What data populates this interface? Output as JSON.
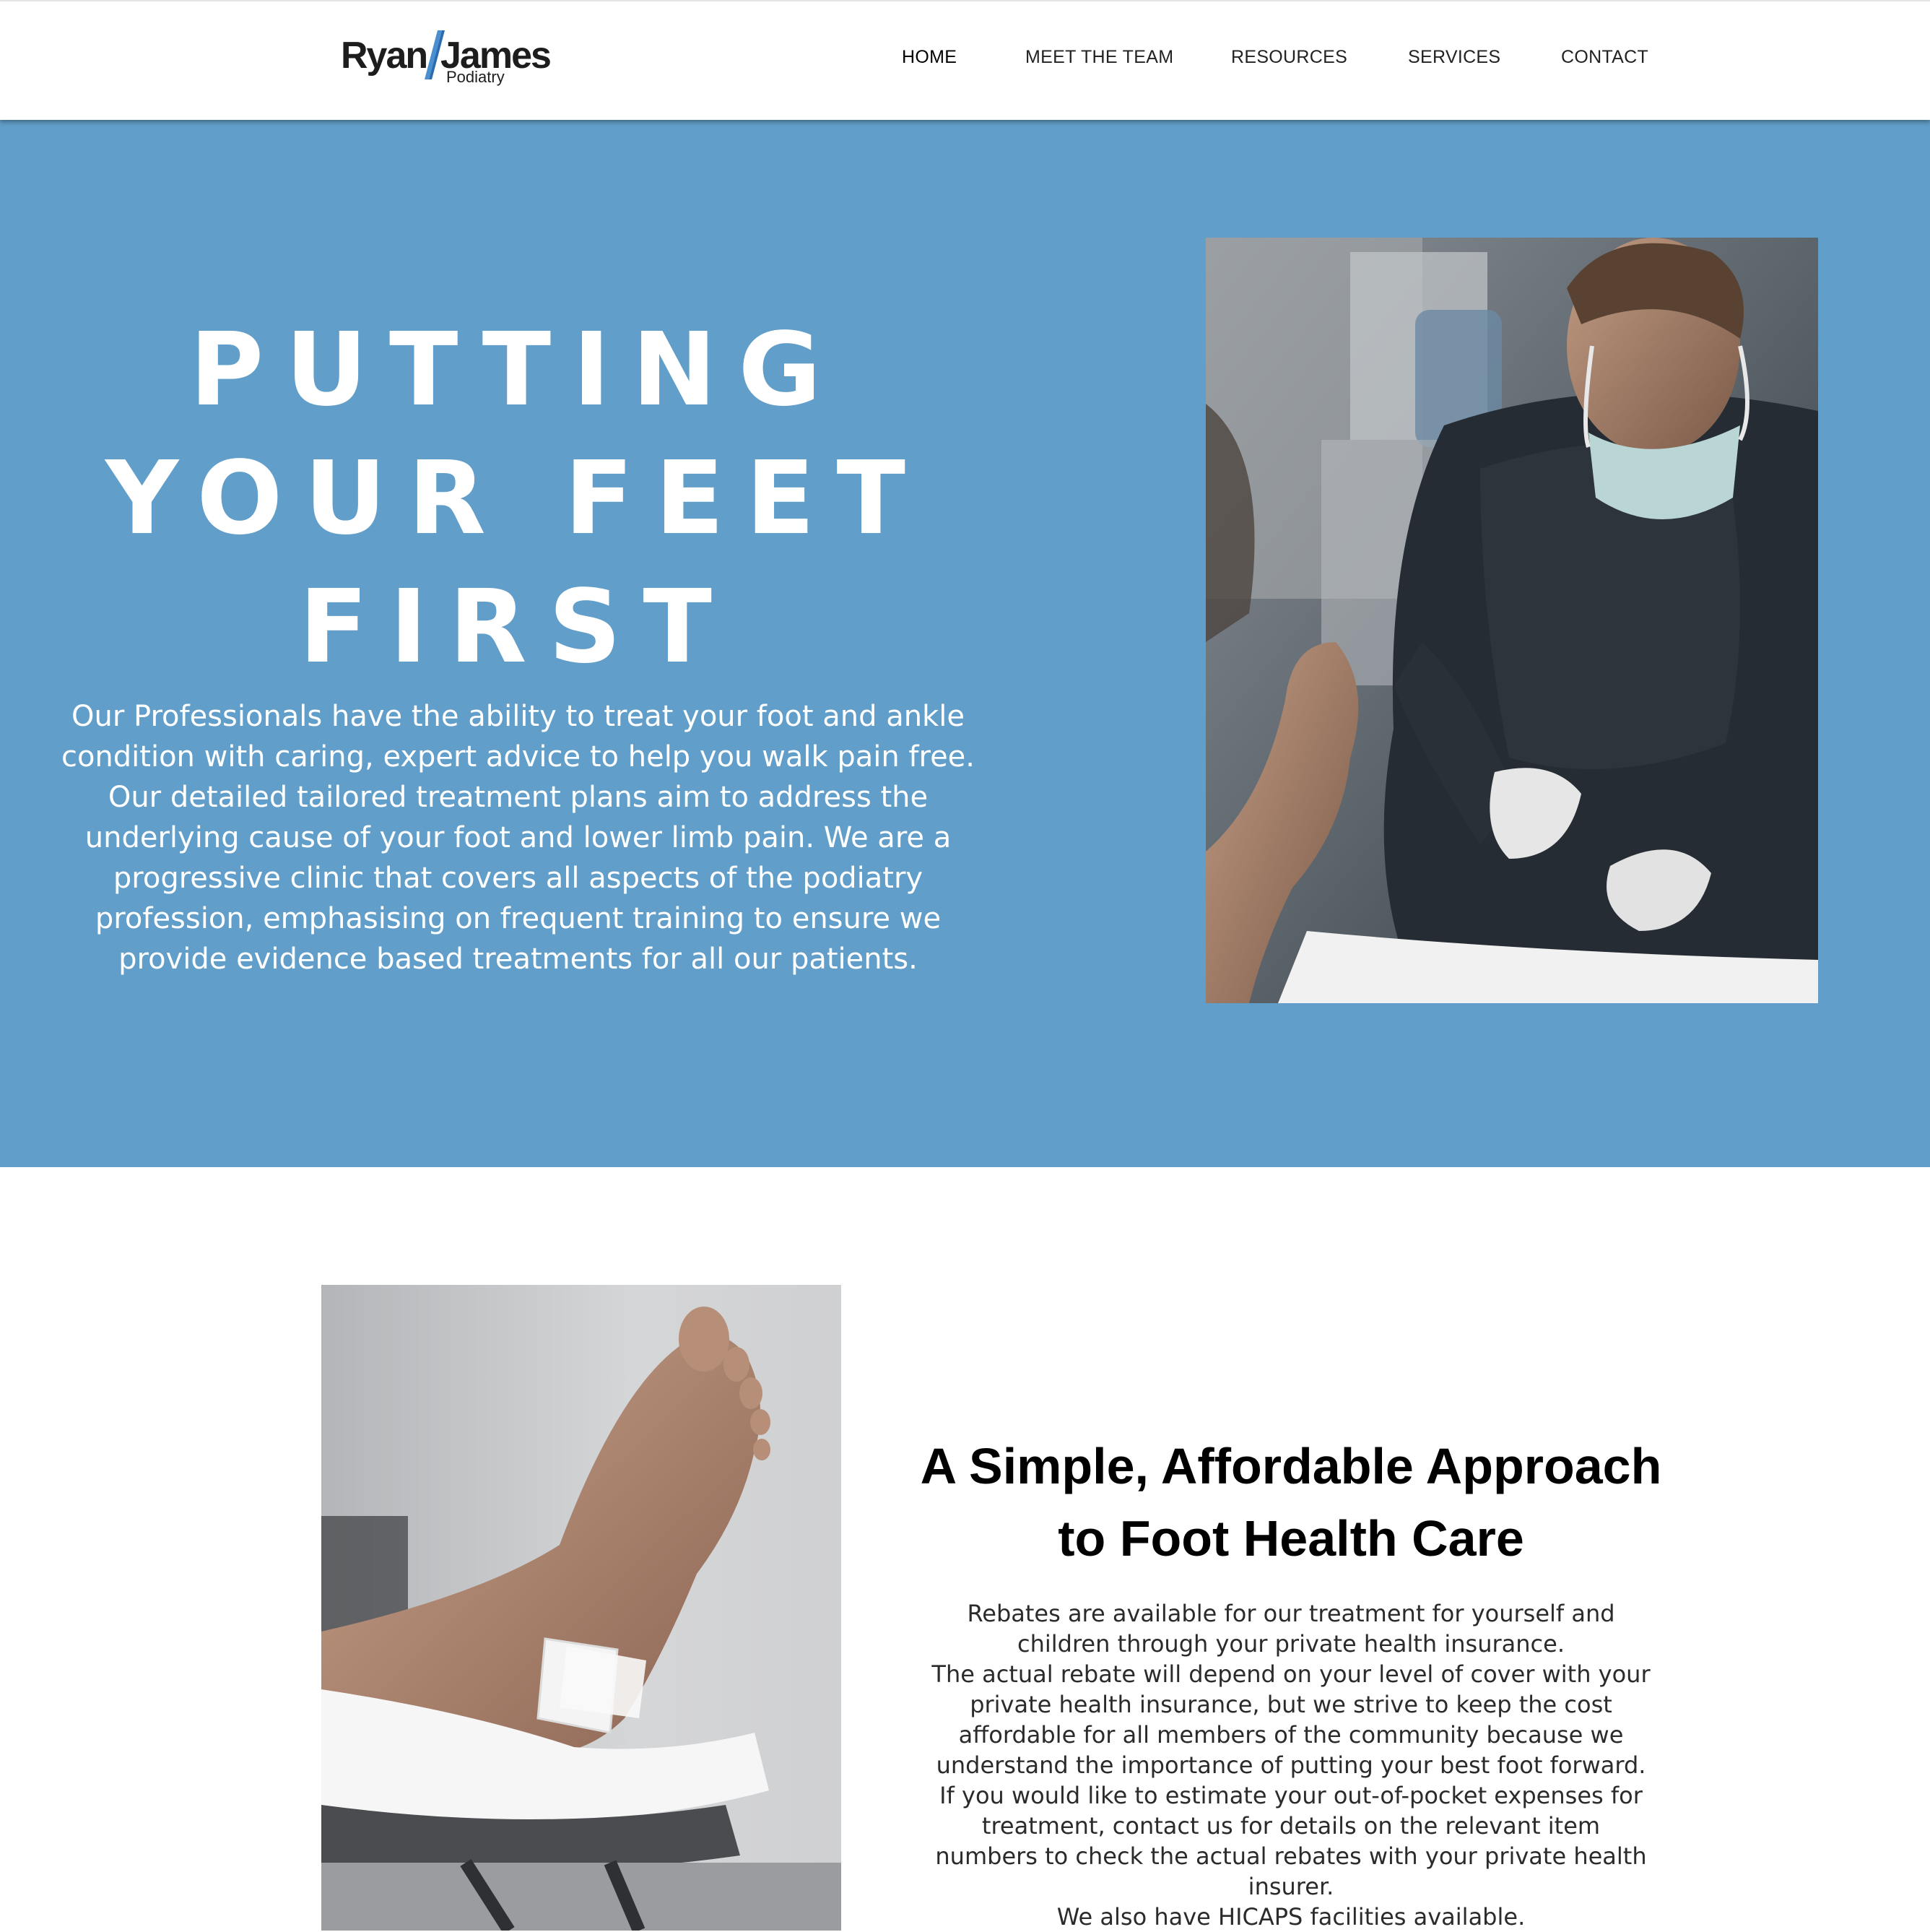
{
  "header": {
    "logo": {
      "word_left": "Ryan",
      "word_right": "James",
      "subtitle": "Podiatry",
      "accent_color": "#4a8fd0"
    },
    "nav": [
      {
        "label": "HOME",
        "active": true
      },
      {
        "label": "MEET THE TEAM",
        "active": false
      },
      {
        "label": "RESOURCES",
        "active": false
      },
      {
        "label": "SERVICES",
        "active": false
      },
      {
        "label": "CONTACT",
        "active": false
      }
    ]
  },
  "hero": {
    "background_color": "#619ec9",
    "title_lines": [
      "PUTTING",
      "YOUR FEET",
      "FIRST"
    ],
    "description": "Our Professionals have the ability to treat your foot and ankle condition with caring, expert advice to help you walk pain free.  Our detailed tailored treatment plans aim to address the underlying cause of your foot and lower limb pain. We are a progressive clinic that covers all aspects of the podiatry profession, emphasising on frequent training to ensure we provide evidence based treatments for all our patients."
  },
  "affordable": {
    "title": "A Simple, Affordable Approach to Foot Health Care",
    "paragraphs": [
      "Rebates are available for our treatment for yourself and children through your private health insurance.",
      "The actual rebate will depend on your level of cover with your private health insurance, but we strive to keep the cost affordable for all members of the community because we understand the importance of putting your best foot forward.",
      "If you would like to estimate your out-of-pocket expenses for treatment, contact us for details on the relevant item numbers to check the actual rebates with your private health insurer.",
      "We also have HICAPS facilities available."
    ]
  }
}
